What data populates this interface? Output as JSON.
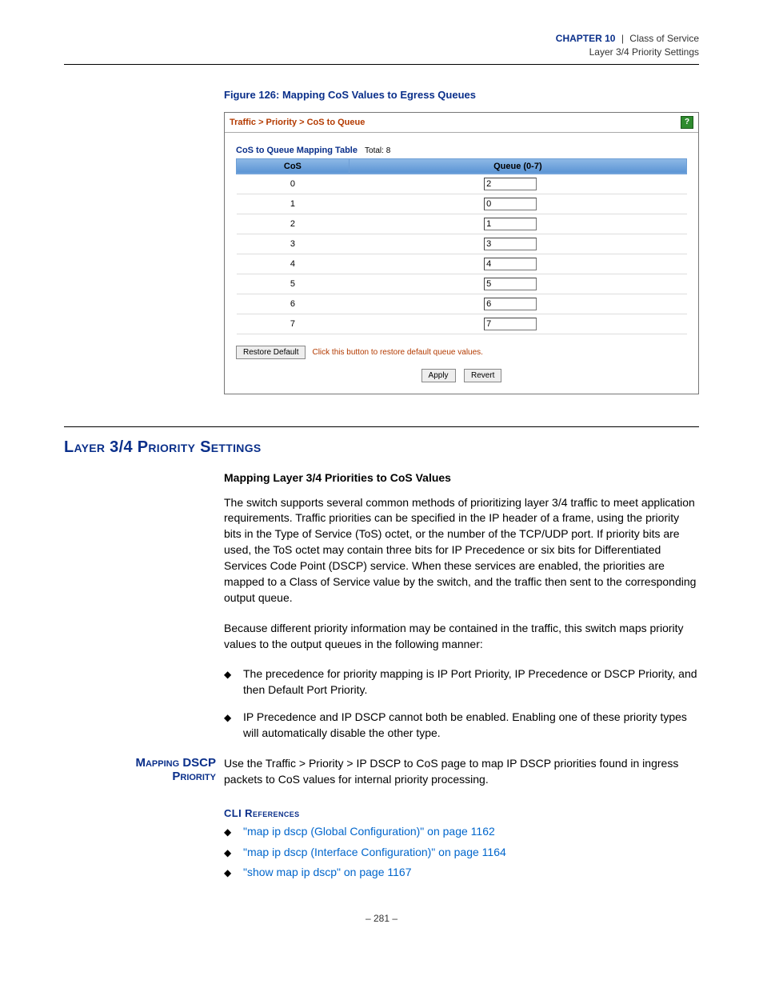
{
  "running_head": {
    "chapter": "CHAPTER 10",
    "bar": "|",
    "topic": "Class of Service",
    "subtopic": "Layer 3/4 Priority Settings"
  },
  "figure": {
    "caption": "Figure 126:  Mapping CoS Values to Egress Queues",
    "breadcrumb": "Traffic > Priority > CoS to Queue",
    "help_glyph": "?",
    "table_title": "CoS to Queue Mapping Table",
    "total_label": "Total: 8",
    "col_cos": "CoS",
    "col_queue": "Queue (0-7)",
    "rows": [
      {
        "cos": "0",
        "queue": "2"
      },
      {
        "cos": "1",
        "queue": "0"
      },
      {
        "cos": "2",
        "queue": "1"
      },
      {
        "cos": "3",
        "queue": "3"
      },
      {
        "cos": "4",
        "queue": "4"
      },
      {
        "cos": "5",
        "queue": "5"
      },
      {
        "cos": "6",
        "queue": "6"
      },
      {
        "cos": "7",
        "queue": "7"
      }
    ],
    "restore_default": "Restore Default",
    "restore_msg": "Click this button to restore default queue values.",
    "apply": "Apply",
    "revert": "Revert"
  },
  "section": {
    "title": "Layer 3/4 Priority Settings",
    "subheading": "Mapping Layer 3/4 Priorities to CoS Values",
    "para1": "The switch supports several common methods of prioritizing layer 3/4 traffic to meet application requirements. Traffic priorities can be specified in the IP header of a frame, using the priority bits in the Type of Service (ToS) octet, or the number of the TCP/UDP port. If priority bits are used, the ToS octet may contain three bits for IP Precedence or six bits for Differentiated Services Code Point (DSCP) service. When these services are enabled, the priorities are mapped to a Class of Service value by the switch, and the traffic then sent to the corresponding output queue.",
    "para2": "Because different priority information may be contained in the traffic, this switch maps priority values to the output queues in the following manner:",
    "bullets": [
      "The precedence for priority mapping is IP Port Priority, IP Precedence or DSCP Priority, and then Default Port Priority.",
      "IP Precedence and IP DSCP cannot both be enabled. Enabling one of these priority types will automatically disable the other type."
    ]
  },
  "side": {
    "heading_line1": "Mapping DSCP",
    "heading_line2": "Priority",
    "body": "Use the Traffic > Priority > IP DSCP to CoS page to map IP DSCP priorities found in ingress packets to CoS values for internal priority processing."
  },
  "cli": {
    "heading": "CLI References",
    "links": [
      "\"map ip dscp (Global Configuration)\" on page 1162",
      "\"map ip dscp (Interface Configuration)\" on page 1164",
      "\"show map ip dscp\" on page 1167"
    ]
  },
  "footer": "–  281  –"
}
